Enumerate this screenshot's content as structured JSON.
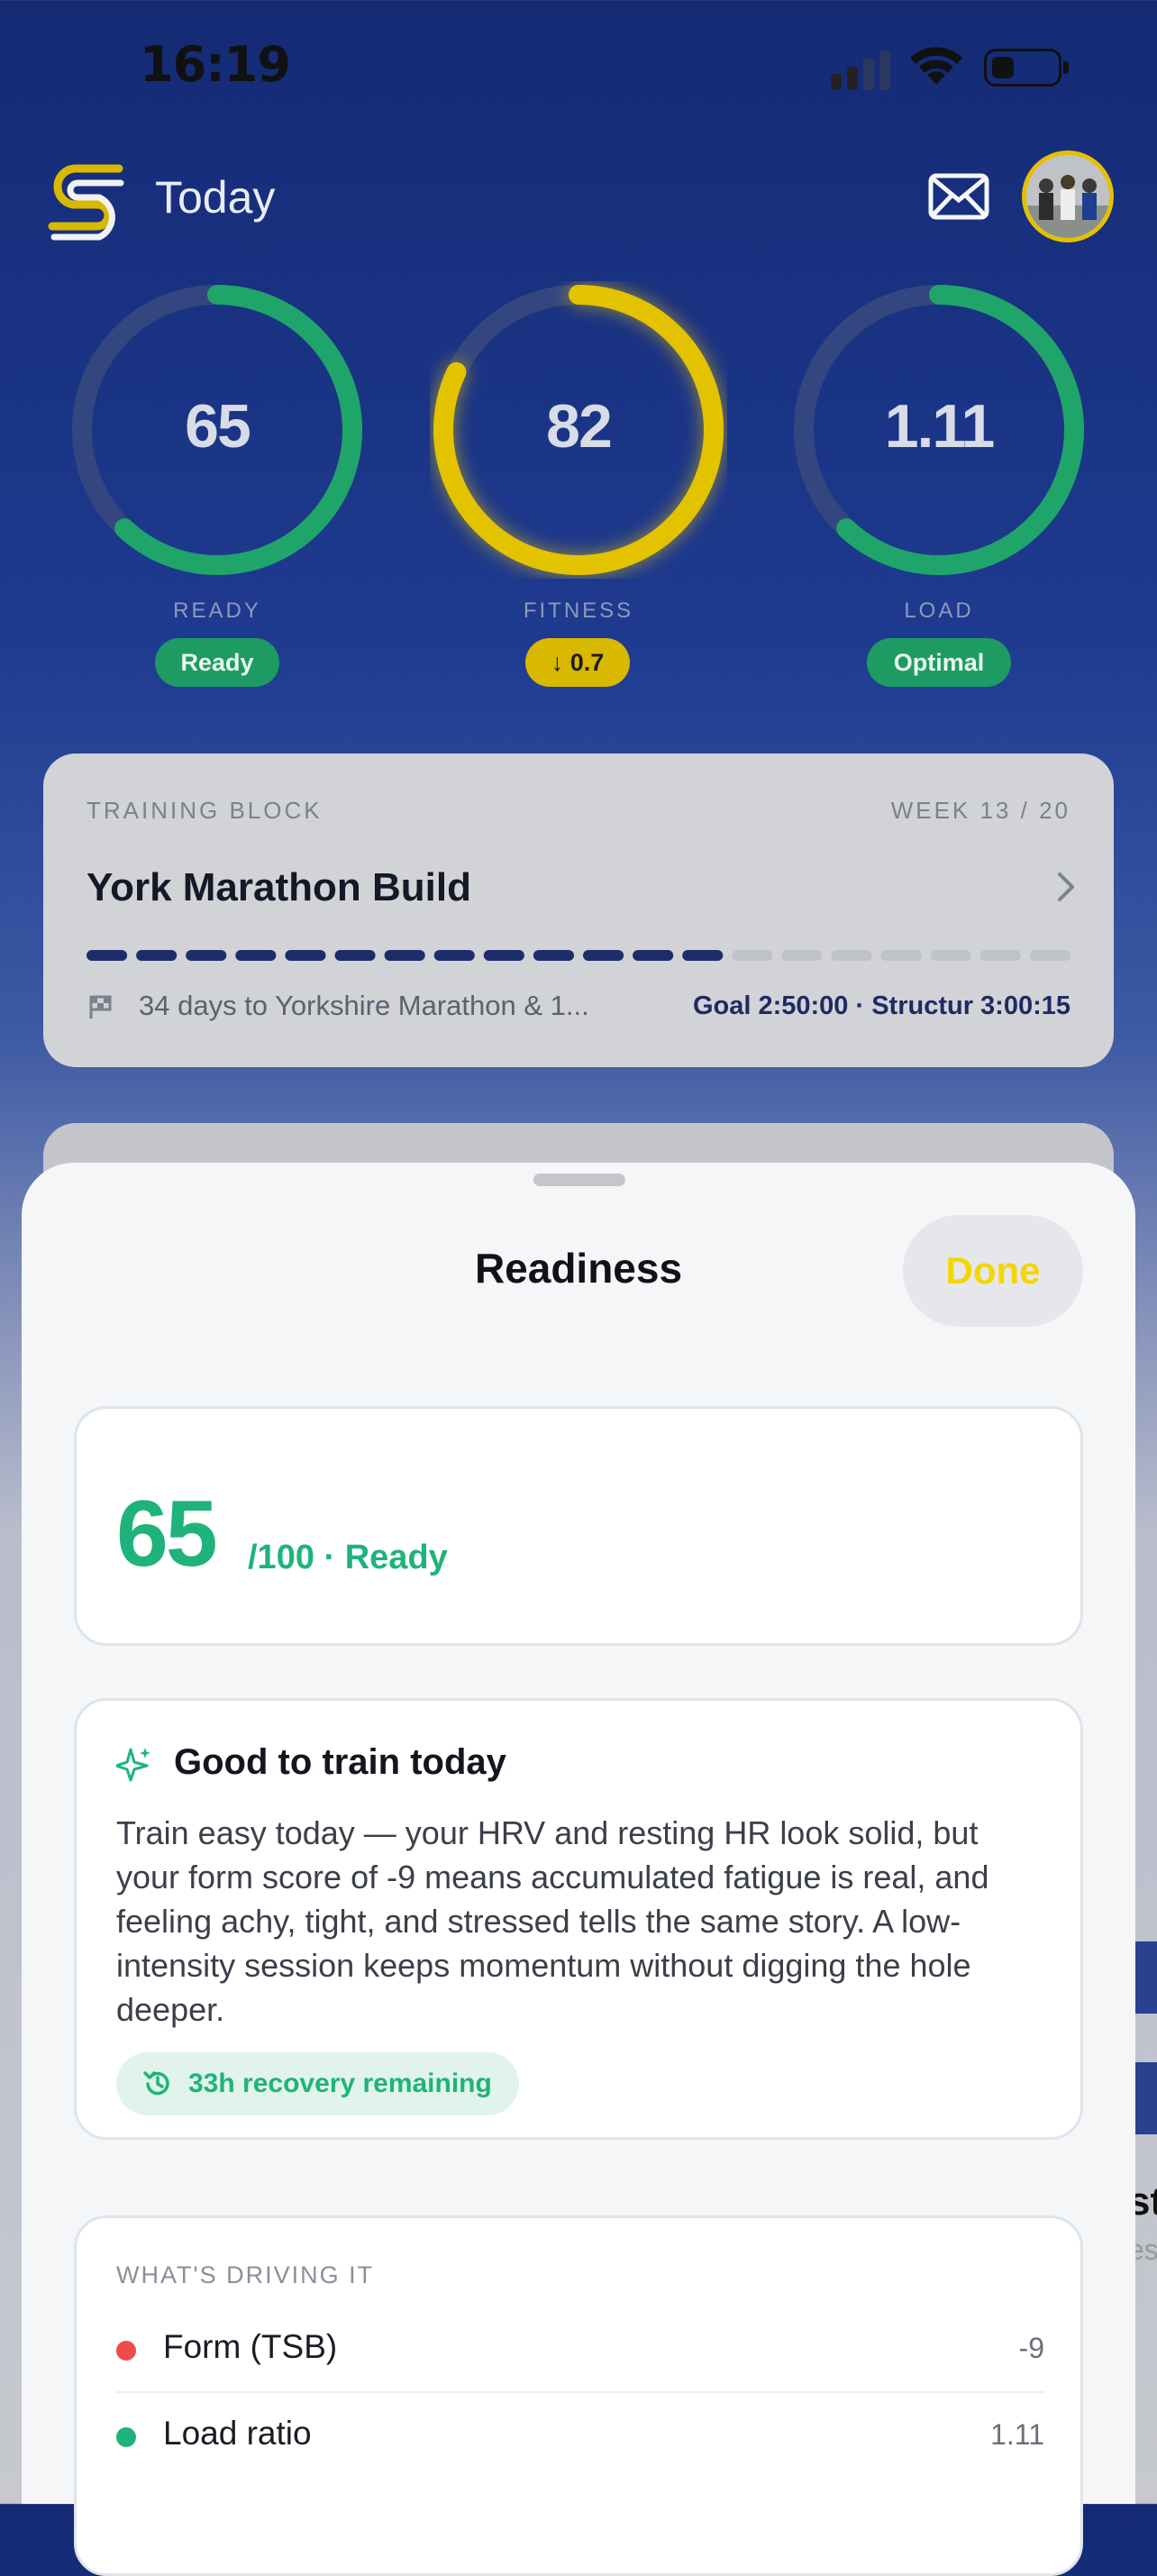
{
  "status": {
    "time": "16:19"
  },
  "header": {
    "title": "Today"
  },
  "rings": [
    {
      "value": "65",
      "label": "READY",
      "badge": "Ready",
      "progress": 0.62,
      "color": "#1fa56a",
      "badge_color": "#1e9b62"
    },
    {
      "value": "82",
      "label": "FITNESS",
      "badge": "↓ 0.7",
      "progress": 0.82,
      "color": "#e3c200",
      "badge_color": "#d9b800"
    },
    {
      "value": "1.11",
      "label": "LOAD",
      "badge": "Optimal",
      "progress": 0.62,
      "color": "#1fa56a",
      "badge_color": "#1e9b62"
    }
  ],
  "training_block": {
    "caption": "TRAINING BLOCK",
    "week": "WEEK 13 / 20",
    "name": "York Marathon Build",
    "segments_done": 13,
    "segments_total": 20,
    "days_text": "34 days to Yorkshire Marathon & 1...",
    "goal_text": "Goal 2:50:00 · Structur 3:00:15"
  },
  "side_peek": {
    "text1": "st",
    "text2": "es"
  },
  "sheet": {
    "title": "Readiness",
    "done_label": "Done",
    "score": "65",
    "score_suffix": "/100 · Ready",
    "headline": "Good to train today",
    "body": "Train easy today — your HRV and resting HR look solid, but your form score of -9 means accumulated fatigue is real, and feeling achy, tight, and stressed tells the same story. A low-intensity session keeps momentum without digging the hole deeper.",
    "recovery": "33h recovery remaining",
    "drivers_caption": "WHAT'S DRIVING IT",
    "drivers": [
      {
        "label": "Form (TSB)",
        "value": "-9",
        "color": "#ef4b4b"
      },
      {
        "label": "Load ratio",
        "value": "1.11",
        "color": "#1fb37c"
      }
    ]
  }
}
